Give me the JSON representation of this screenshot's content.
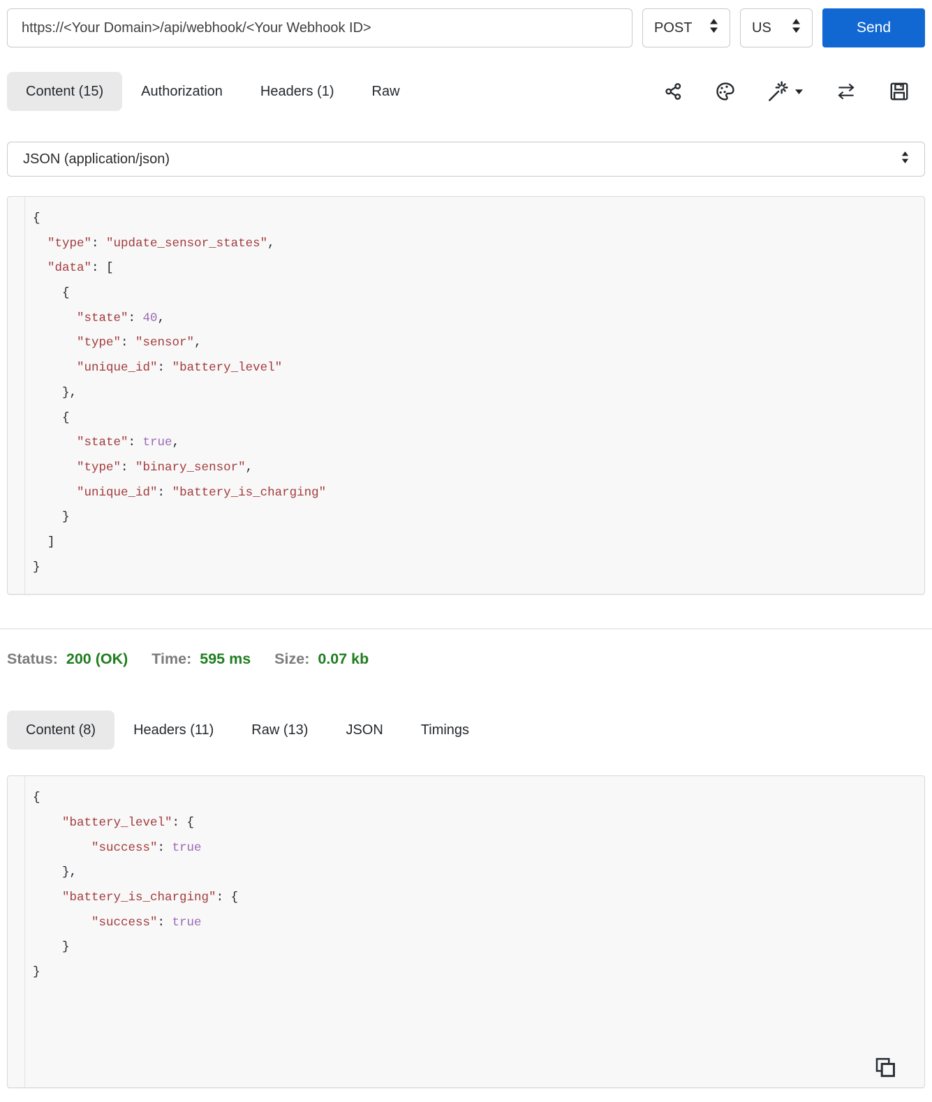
{
  "request_bar": {
    "url": "https://<Your Domain>/api/webhook/<Your Webhook ID>",
    "method": "POST",
    "locale": "US",
    "send_label": "Send"
  },
  "request_tabs": [
    {
      "label": "Content (15)",
      "active": true
    },
    {
      "label": "Authorization",
      "active": false
    },
    {
      "label": "Headers (1)",
      "active": false
    },
    {
      "label": "Raw",
      "active": false
    }
  ],
  "toolbar_icons": [
    {
      "name": "share-icon"
    },
    {
      "name": "palette-icon"
    },
    {
      "name": "magic-wand-menu-icon"
    },
    {
      "name": "swap-icon"
    },
    {
      "name": "save-icon"
    }
  ],
  "content_type_select": {
    "value": "JSON (application/json)"
  },
  "request_body": {
    "lines": [
      [
        [
          "p",
          "{"
        ]
      ],
      [
        [
          "p",
          "  "
        ],
        [
          "k",
          "\"type\""
        ],
        [
          "p",
          ": "
        ],
        [
          "s",
          "\"update_sensor_states\""
        ],
        [
          "p",
          ","
        ]
      ],
      [
        [
          "p",
          "  "
        ],
        [
          "k",
          "\"data\""
        ],
        [
          "p",
          ": ["
        ]
      ],
      [
        [
          "p",
          "    {"
        ]
      ],
      [
        [
          "p",
          "      "
        ],
        [
          "k",
          "\"state\""
        ],
        [
          "p",
          ": "
        ],
        [
          "n",
          "40"
        ],
        [
          "p",
          ","
        ]
      ],
      [
        [
          "p",
          "      "
        ],
        [
          "k",
          "\"type\""
        ],
        [
          "p",
          ": "
        ],
        [
          "s",
          "\"sensor\""
        ],
        [
          "p",
          ","
        ]
      ],
      [
        [
          "p",
          "      "
        ],
        [
          "k",
          "\"unique_id\""
        ],
        [
          "p",
          ": "
        ],
        [
          "s",
          "\"battery_level\""
        ]
      ],
      [
        [
          "p",
          "    },"
        ]
      ],
      [
        [
          "p",
          "    {"
        ]
      ],
      [
        [
          "p",
          "      "
        ],
        [
          "k",
          "\"state\""
        ],
        [
          "p",
          ": "
        ],
        [
          "b",
          "true"
        ],
        [
          "p",
          ","
        ]
      ],
      [
        [
          "p",
          "      "
        ],
        [
          "k",
          "\"type\""
        ],
        [
          "p",
          ": "
        ],
        [
          "s",
          "\"binary_sensor\""
        ],
        [
          "p",
          ","
        ]
      ],
      [
        [
          "p",
          "      "
        ],
        [
          "k",
          "\"unique_id\""
        ],
        [
          "p",
          ": "
        ],
        [
          "s",
          "\"battery_is_charging\""
        ]
      ],
      [
        [
          "p",
          "    }"
        ]
      ],
      [
        [
          "p",
          "  ]"
        ]
      ],
      [
        [
          "p",
          "}"
        ]
      ]
    ]
  },
  "response_meta": {
    "status_label": "Status:",
    "status_value": "200 (OK)",
    "time_label": "Time:",
    "time_value": "595 ms",
    "size_label": "Size:",
    "size_value": "0.07 kb"
  },
  "response_tabs": [
    {
      "label": "Content (8)",
      "active": true
    },
    {
      "label": "Headers (11)",
      "active": false
    },
    {
      "label": "Raw (13)",
      "active": false
    },
    {
      "label": "JSON",
      "active": false
    },
    {
      "label": "Timings",
      "active": false
    }
  ],
  "response_body": {
    "lines": [
      [
        [
          "p",
          "{"
        ]
      ],
      [
        [
          "p",
          "    "
        ],
        [
          "k",
          "\"battery_level\""
        ],
        [
          "p",
          ": {"
        ]
      ],
      [
        [
          "p",
          "        "
        ],
        [
          "k",
          "\"success\""
        ],
        [
          "p",
          ": "
        ],
        [
          "b",
          "true"
        ]
      ],
      [
        [
          "p",
          "    },"
        ]
      ],
      [
        [
          "p",
          "    "
        ],
        [
          "k",
          "\"battery_is_charging\""
        ],
        [
          "p",
          ": {"
        ]
      ],
      [
        [
          "p",
          "        "
        ],
        [
          "k",
          "\"success\""
        ],
        [
          "p",
          ": "
        ],
        [
          "b",
          "true"
        ]
      ],
      [
        [
          "p",
          "    }"
        ]
      ],
      [
        [
          "p",
          "}"
        ]
      ]
    ]
  },
  "colors": {
    "accent_blue": "#1268d3",
    "status_green": "#1f7d1f",
    "label_gray": "#7b7b7b",
    "syntax_string": "#a33b3b",
    "syntax_literal": "#9b69b4",
    "syntax_punctuation": "#1f2328",
    "code_background": "#f8f8f9",
    "active_tab_background": "#e9e9ea"
  }
}
